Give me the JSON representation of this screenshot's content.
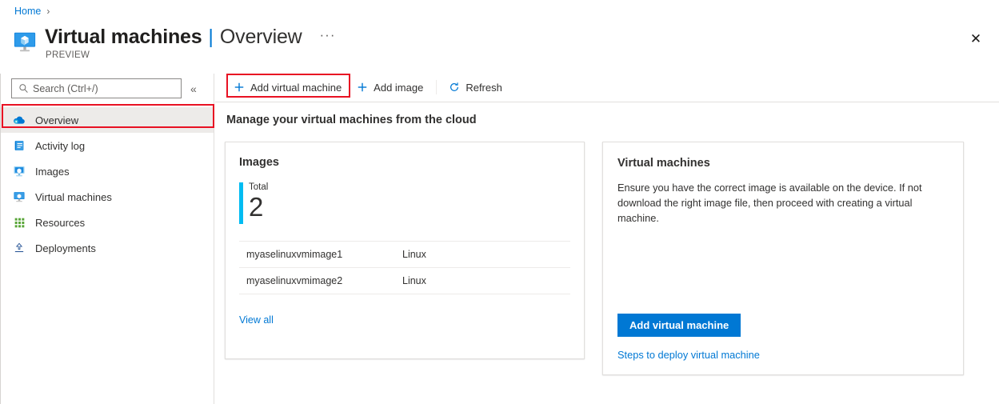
{
  "breadcrumb": {
    "home_label": "Home",
    "separator": "›"
  },
  "header": {
    "icon_name": "virtual-machine-icon",
    "title": "Virtual machines",
    "title_divider": "|",
    "subtitle": "Overview",
    "ellipsis": "···",
    "preview_label": "PREVIEW",
    "close_label": "✕"
  },
  "sidebar": {
    "search": {
      "placeholder": "Search (Ctrl+/)",
      "value": ""
    },
    "collapse_label": "«",
    "items": [
      {
        "label": "Overview",
        "icon": "cloud-icon",
        "selected": true
      },
      {
        "label": "Activity log",
        "icon": "activity-log-icon",
        "selected": false
      },
      {
        "label": "Images",
        "icon": "images-icon",
        "selected": false
      },
      {
        "label": "Virtual machines",
        "icon": "virtual-machine-icon",
        "selected": false
      },
      {
        "label": "Resources",
        "icon": "resources-grid-icon",
        "selected": false
      },
      {
        "label": "Deployments",
        "icon": "upload-icon",
        "selected": false
      }
    ]
  },
  "toolbar": {
    "add_vm_label": "Add virtual machine",
    "add_image_label": "Add image",
    "refresh_label": "Refresh",
    "add_icon": "plus-icon",
    "refresh_icon": "refresh-icon"
  },
  "main": {
    "section_heading": "Manage your virtual machines from the cloud",
    "images_card": {
      "title": "Images",
      "total_label": "Total",
      "total_value": "2",
      "accent_color": "#00bcf2",
      "columns": [
        "name",
        "os"
      ],
      "rows": [
        {
          "name": "myaselinuxvmimage1",
          "os": "Linux"
        },
        {
          "name": "myaselinuxvmimage2",
          "os": "Linux"
        }
      ],
      "view_all_label": "View all"
    },
    "vms_card": {
      "title": "Virtual machines",
      "description": "Ensure you have the correct image is available on the device. If not download the right image file, then proceed with creating a virtual machine.",
      "button_label": "Add virtual machine",
      "button_color": "#0078d4",
      "link_label": "Steps to deploy virtual machine"
    }
  },
  "annotations": {
    "highlight_color": "#e81123"
  }
}
